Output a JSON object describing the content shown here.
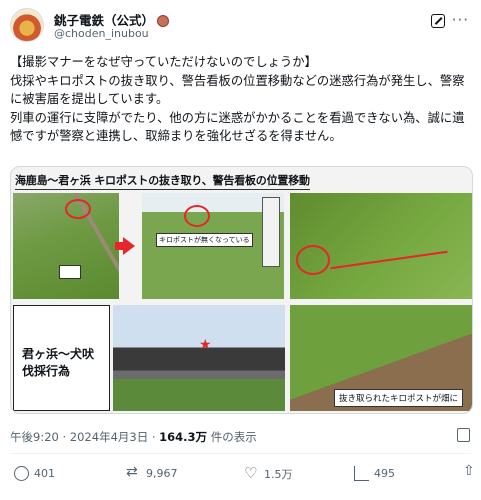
{
  "author": {
    "display_name": "銚子電鉄（公式）",
    "handle": "@choden_inubou"
  },
  "post": {
    "text": "【撮影マナーをなぜ守っていただけないのでしょうか】\n伐採やキロポストの抜き取り、警告看板の位置移動などの迷惑行為が発生し、警察に被害届を提出しています。\n列車の運行に支障がでたり、他の方に迷惑がかかることを看過できない為、誠に遺憾ですが警察と連携し、取締まりを強化せざるを得ません。"
  },
  "media": {
    "title": "海鹿島～君ヶ浜 キロポストの抜き取り、警告看板の位置移動",
    "missing_label": "キロポストが無くなっている",
    "panel_label": "君ヶ浜～犬吠\n伐採行為",
    "bottom_caption": "抜き取られたキロポストが畑に"
  },
  "meta": {
    "time": "午後9:20",
    "date": "2024年4月3日",
    "separator": "·",
    "views_count": "164.3万",
    "views_label": "件の表示"
  },
  "actions": {
    "replies": "401",
    "reposts": "9,967",
    "likes": "1.5万",
    "views": "495"
  },
  "icons": {
    "more": "more-icon",
    "grok": "grok-icon",
    "reply": "reply-icon",
    "retweet": "retweet-icon",
    "like": "like-icon",
    "views": "views-icon",
    "bookmark": "bookmark-icon",
    "share": "share-icon",
    "analytics": "analytics-icon"
  },
  "colors": {
    "text_primary": "#0f1419",
    "text_secondary": "#536471",
    "highlight_red": "#e5262a"
  }
}
